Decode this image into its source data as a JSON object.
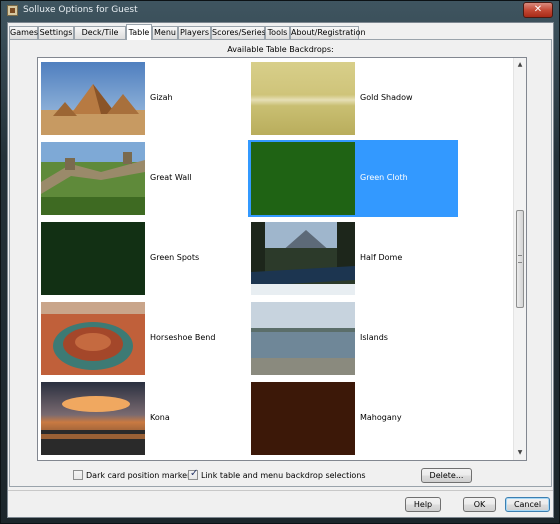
{
  "window": {
    "title": "Solluxe Options for Guest",
    "close_glyph": "✕"
  },
  "tabs": [
    {
      "label": "Games"
    },
    {
      "label": "Settings"
    },
    {
      "label": "Deck/Tile Set"
    },
    {
      "label": "Table"
    },
    {
      "label": "Menu"
    },
    {
      "label": "Players"
    },
    {
      "label": "Scores/Series"
    },
    {
      "label": "Tools"
    },
    {
      "label": "About/Registration"
    }
  ],
  "active_tab": "Table",
  "heading": "Available Table Backdrops:",
  "backdrops": [
    {
      "label": "Gizah",
      "icon": "pyramids-image"
    },
    {
      "label": "Gold Shadow",
      "icon": "gold-gradient-image"
    },
    {
      "label": "Great Wall",
      "icon": "great-wall-image"
    },
    {
      "label": "Green Cloth",
      "icon": "green-cloth-image",
      "selected": true
    },
    {
      "label": "Green Spots",
      "icon": "dark-green-image"
    },
    {
      "label": "Half Dome",
      "icon": "snowy-river-image"
    },
    {
      "label": "Horseshoe Bend",
      "icon": "canyon-image"
    },
    {
      "label": "Islands",
      "icon": "lake-image"
    },
    {
      "label": "Kona",
      "icon": "sunset-image"
    },
    {
      "label": "Mahogany",
      "icon": "mahogany-image"
    }
  ],
  "options": {
    "dark_markers": {
      "label": "Dark card position markers",
      "checked": false
    },
    "link_backdrops": {
      "label": "Link table and menu backdrop selections",
      "checked": true,
      "check_glyph": "✓"
    }
  },
  "buttons": {
    "delete": "Delete...",
    "help": "Help",
    "ok": "OK",
    "cancel": "Cancel"
  },
  "scrollbar": {
    "up_glyph": "▲",
    "down_glyph": "▼"
  },
  "colors": {
    "selection": "#3399ff",
    "window_frame": "#24323a",
    "dialog_bg": "#f0f0f0"
  }
}
